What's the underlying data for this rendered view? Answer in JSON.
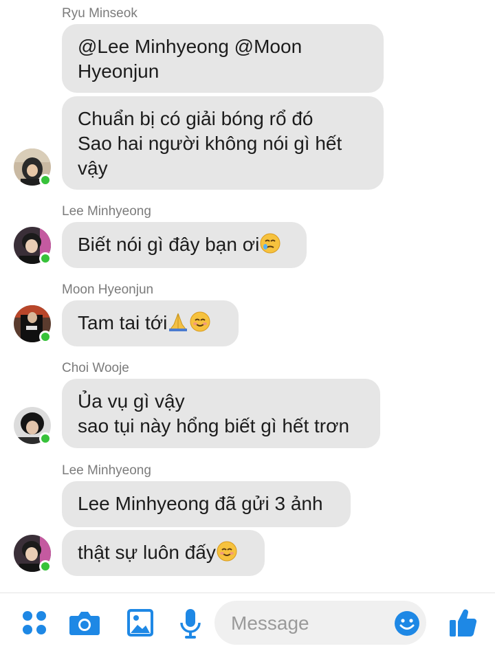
{
  "conversation": {
    "groups": [
      {
        "sender": "Ryu Minseok",
        "messages": [
          "@Lee Minhyeong @Moon\nHyeonjun",
          "Chuẩn bị có giải bóng rổ đó\nSao hai người không nói gì hết\nvậy"
        ]
      },
      {
        "sender": "Lee Minhyeong",
        "messages": [
          "Biết nói gì đây bạn ơi"
        ]
      },
      {
        "sender": "Moon Hyeonjun",
        "messages": [
          "Tam tai tới"
        ]
      },
      {
        "sender": "Choi Wooje",
        "messages": [
          "Ủa vụ gì vậy\nsao tụi này hổng biết gì hết trơn"
        ]
      },
      {
        "sender": "Lee Minhyeong",
        "messages": [
          "Lee Minhyeong đã gửi 3 ảnh",
          "thật sự luôn đấy"
        ]
      }
    ]
  },
  "composer": {
    "placeholder": "Message",
    "icons": [
      "menu-dots-icon",
      "camera-icon",
      "image-icon",
      "microphone-icon",
      "emoji-icon",
      "thumbs-up-icon"
    ]
  },
  "colors": {
    "accent": "#1e88e5",
    "bubble": "#e6e6e6",
    "online": "#37c23a"
  }
}
